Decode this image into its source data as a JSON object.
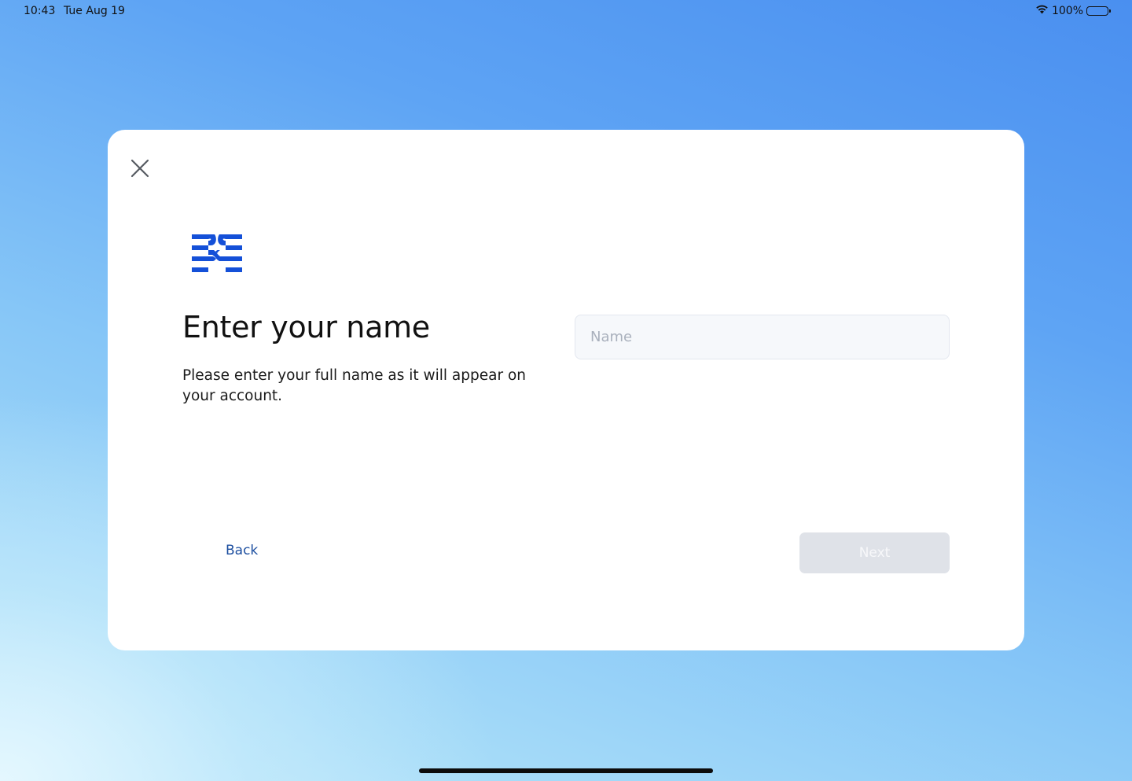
{
  "status_bar": {
    "time": "10:43",
    "date": "Tue Aug 19",
    "battery": "100%"
  },
  "dialog": {
    "close_icon": "close-icon",
    "logo_icon": "brand-logo",
    "title": "Enter your name",
    "subtitle": "Please enter your full name as it will appear on your account.",
    "name_field": {
      "value": "",
      "placeholder": "Name"
    },
    "back_label": "Back",
    "next_label": "Next",
    "next_enabled": false
  },
  "colors": {
    "brand_blue": "#1450d8",
    "link_blue": "#1d4fa0",
    "disabled_button": "#dfe2e8"
  }
}
